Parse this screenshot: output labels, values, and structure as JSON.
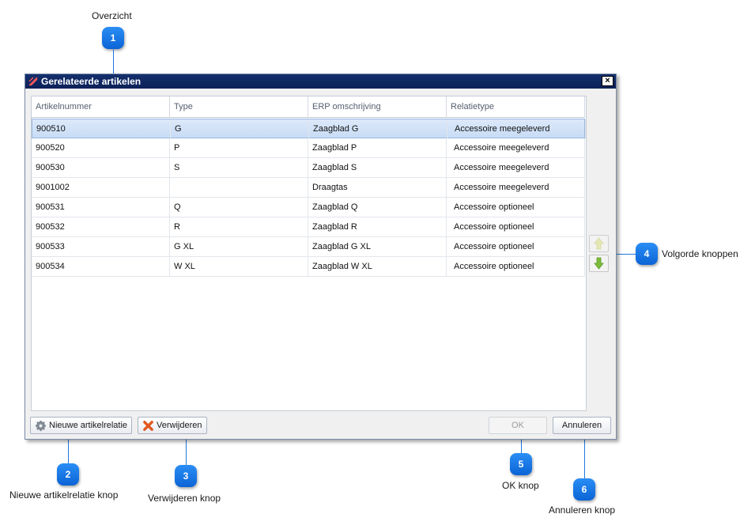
{
  "callouts": {
    "overview": {
      "number": "1",
      "label": "Overzicht"
    },
    "new_relation": {
      "number": "2",
      "label": "Nieuwe artikelrelatie knop"
    },
    "delete": {
      "number": "3",
      "label": "Verwijderen knop"
    },
    "order": {
      "number": "4",
      "label": "Volgorde knoppen"
    },
    "ok": {
      "number": "5",
      "label": "OK knop"
    },
    "cancel": {
      "number": "6",
      "label": "Annuleren knop"
    }
  },
  "dialog": {
    "title": "Gerelateerde artikelen",
    "close_label": "×"
  },
  "grid": {
    "columns": [
      "Artikelnummer",
      "Type",
      "ERP omschrijving",
      "Relatietype"
    ],
    "rows": [
      {
        "artikelnummer": "900510",
        "type": "G",
        "omschrijving": "Zaagblad G",
        "relatietype": "Accessoire meegeleverd",
        "selected": true
      },
      {
        "artikelnummer": "900520",
        "type": "P",
        "omschrijving": "Zaagblad P",
        "relatietype": "Accessoire meegeleverd"
      },
      {
        "artikelnummer": "900530",
        "type": "S",
        "omschrijving": "Zaagblad S",
        "relatietype": "Accessoire meegeleverd"
      },
      {
        "artikelnummer": "9001002",
        "type": "",
        "omschrijving": "Draagtas",
        "relatietype": "Accessoire meegeleverd"
      },
      {
        "artikelnummer": "900531",
        "type": "Q",
        "omschrijving": "Zaagblad Q",
        "relatietype": "Accessoire optioneel"
      },
      {
        "artikelnummer": "900532",
        "type": "R",
        "omschrijving": "Zaagblad R",
        "relatietype": "Accessoire optioneel"
      },
      {
        "artikelnummer": "900533",
        "type": "G XL",
        "omschrijving": "Zaagblad G XL",
        "relatietype": "Accessoire optioneel"
      },
      {
        "artikelnummer": "900534",
        "type": "W XL",
        "omschrijving": "Zaagblad W XL",
        "relatietype": "Accessoire optioneel"
      }
    ]
  },
  "buttons": {
    "new_relation": "Nieuwe artikelrelatie",
    "delete": "Verwijderen",
    "ok": "OK",
    "cancel": "Annuleren"
  },
  "icons": {
    "title": "relation-icon",
    "new_relation": "gear-icon",
    "delete": "red-x-icon",
    "move_up": "arrow-up-icon",
    "move_down": "arrow-down-icon"
  },
  "colors": {
    "titlebar": "#0b2158",
    "callout": "#1f78e0",
    "selected_row": "#c8dcf5",
    "arrow_down": "#7dbb3a",
    "arrow_up_disabled": "#e3e6a8"
  }
}
